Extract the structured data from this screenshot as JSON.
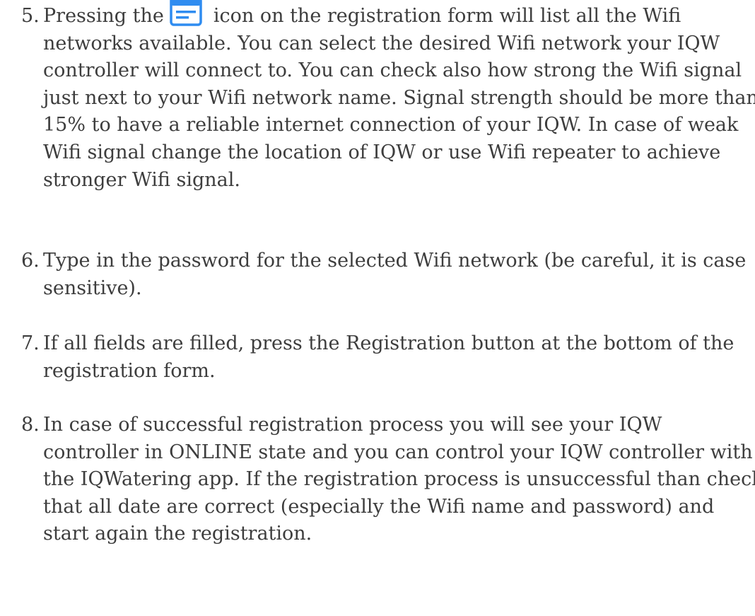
{
  "steps": [
    {
      "number": "5.",
      "before_icon": "Pressing the",
      "icon": "network-list-icon",
      "lines": [
        "icon on the registration form will list all the Wifi",
        "networks available. You can select the desired Wifi network your IQW",
        "controller will connect to. You can check also how strong the Wifi signal",
        "just next to your Wifi network name. Signal strength should be more than",
        "15% to have a reliable internet connection of your IQW. In case of weak",
        "Wifi signal change the location of IQW or use Wifi repeater to achieve",
        "stronger Wifi signal."
      ]
    },
    {
      "number": "6.",
      "lines": [
        "Type in the password for the selected Wifi network (be careful, it is case",
        "sensitive)."
      ]
    },
    {
      "number": "7.",
      "lines": [
        "If all fields are filled, press the Registration button at the bottom of the",
        "registration form."
      ]
    },
    {
      "number": "8.",
      "lines": [
        "In case of successful registration process you will see your IQW",
        "controller in ONLINE state and you can control your IQW controller with",
        "the IQWatering app. If the registration process is unsuccessful than check",
        "that all date are correct (especially the Wifi name and password) and",
        "start again the registration."
      ]
    }
  ],
  "colors": {
    "text": "#3d3d3d",
    "icon_blue": "#2f8cf0"
  }
}
